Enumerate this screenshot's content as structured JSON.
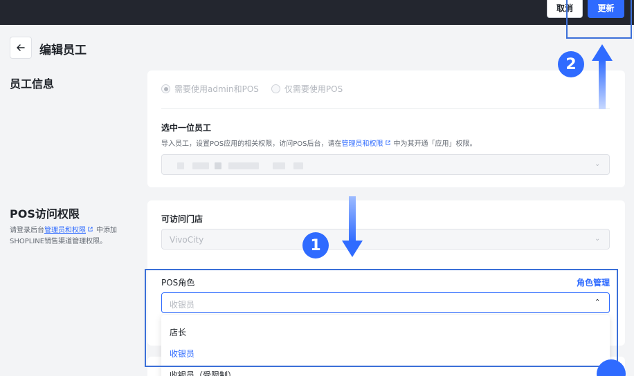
{
  "header": {
    "cancel_label": "取消",
    "update_label": "更新"
  },
  "page": {
    "title": "编辑员工"
  },
  "staff_info": {
    "section_title": "员工信息",
    "radio_admin_pos": "需要使用admin和POS",
    "radio_pos_only": "仅需要使用POS",
    "select_label": "选中一位员工",
    "hint_prefix": "导入员工，设置POS应用的相关权限，访问POS后台，请在",
    "hint_link": "管理员和权限",
    "hint_suffix": "中为其开通「应用」权限。"
  },
  "pos_access": {
    "section_title": "POS访问权限",
    "desc_prefix": "请登录后台",
    "desc_link": "管理员和权限",
    "desc_suffix": "中添加SHOPLINE销售渠道管理权限。",
    "store_label": "可访问门店",
    "store_value": "VivoCity",
    "role_label": "POS角色",
    "role_manage_link": "角色管理",
    "role_placeholder": "收银员",
    "role_options": [
      "店长",
      "收银员",
      "收银员（受限制）"
    ],
    "selected_role_index": 1
  },
  "annotations": {
    "badge_1": "1",
    "badge_2": "2"
  },
  "colors": {
    "accent": "#2f6bff",
    "annotation_border": "#3b6fd8",
    "topbar": "#23262f"
  }
}
